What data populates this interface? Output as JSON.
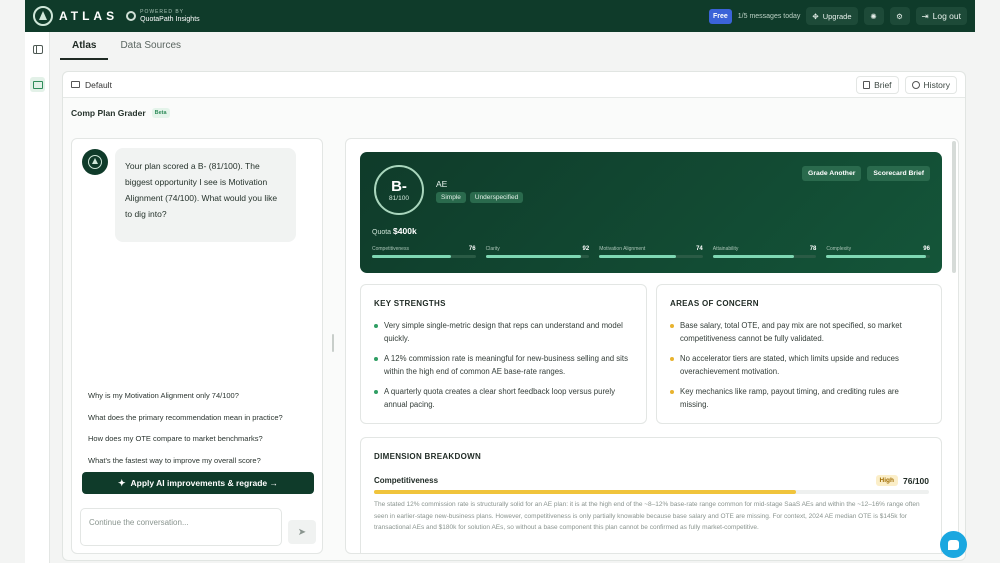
{
  "header": {
    "logo_text": "ATLAS",
    "powered_label": "POWERED BY",
    "powered_brand": "QuotaPath Insights",
    "plan_badge": "Free",
    "messages": "1/5 messages today",
    "upgrade_label": "Upgrade",
    "logout_label": "Log out"
  },
  "tabs": [
    {
      "label": "Atlas",
      "active": true
    },
    {
      "label": "Data Sources",
      "active": false
    }
  ],
  "workspace": {
    "breadcrumb": "Default",
    "brief_label": "Brief",
    "history_label": "History",
    "tool_title": "Comp Plan Grader",
    "beta_label": "Beta"
  },
  "chat": {
    "assistant_message": "Your plan scored a B- (81/100). The biggest opportunity I see is Motivation Alignment (74/100). What would you like to dig into?",
    "suggestions": [
      "Why is my Motivation Alignment only 74/100?",
      "What does the primary recommendation mean in practice?",
      "How does my OTE compare to market benchmarks?",
      "What's the fastest way to improve my overall score?"
    ],
    "apply_label": "Apply AI improvements & regrade →",
    "input_placeholder": "Continue the conversation..."
  },
  "scorecard": {
    "grade": "B-",
    "score": "81/100",
    "role": "AE",
    "tags": [
      "Simple",
      "Underspecified"
    ],
    "grade_another_label": "Grade Another",
    "scorecard_brief_label": "Scorecard Brief",
    "quota_label": "Quota",
    "quota_value": "$400k",
    "metrics": [
      {
        "name": "Competitiveness",
        "value": 76
      },
      {
        "name": "Clarity",
        "value": 92
      },
      {
        "name": "Motivation Alignment",
        "value": 74
      },
      {
        "name": "Attainability",
        "value": 78
      },
      {
        "name": "Complexity",
        "value": 96
      }
    ]
  },
  "strengths": {
    "title": "KEY STRENGTHS",
    "color": "#2f9e63",
    "items": [
      "Very simple single-metric design that reps can understand and model quickly.",
      "A 12% commission rate is meaningful for new-business selling and sits within the high end of common AE base-rate ranges.",
      "A quarterly quota creates a clear short feedback loop versus purely annual pacing."
    ]
  },
  "concerns": {
    "title": "AREAS OF CONCERN",
    "color": "#e8b32e",
    "items": [
      "Base salary, total OTE, and pay mix are not specified, so market competitiveness cannot be fully validated.",
      "No accelerator tiers are stated, which limits upside and reduces overachievement motivation.",
      "Key mechanics like ramp, payout timing, and crediting rules are missing."
    ]
  },
  "breakdown": {
    "title": "DIMENSION BREAKDOWN",
    "dimension": "Competitiveness",
    "badge": "High",
    "score_text": "76/100",
    "fill_fraction": 0.76,
    "text": "The stated 12% commission rate is structurally solid for an AE plan: it is at the high end of the ~8–12% base-rate range common for mid-stage SaaS AEs and within the ~12–16% range often seen in earlier-stage new-business plans. However, competitiveness is only partially knowable because base salary and OTE are missing. For context, 2024 AE median OTE is $145k for transactional AEs and $180k for solution AEs, so without a base component this plan cannot be confirmed as fully market-competitive."
  }
}
